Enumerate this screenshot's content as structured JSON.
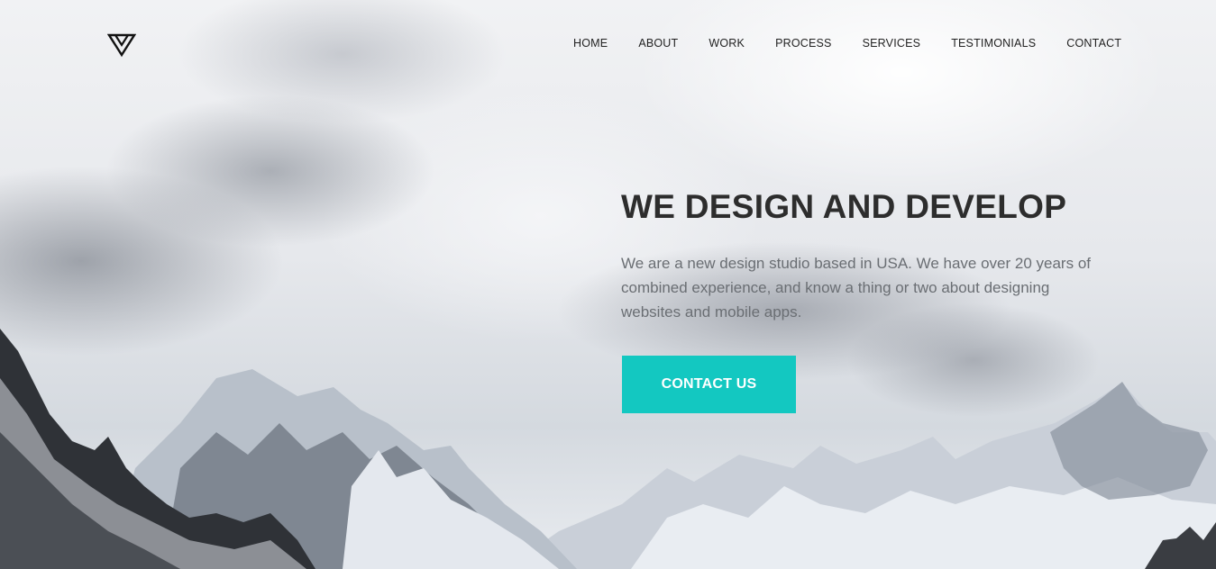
{
  "brand": {
    "logo_icon": "triangle-logo-icon"
  },
  "nav": {
    "items": [
      {
        "label": "HOME"
      },
      {
        "label": "ABOUT"
      },
      {
        "label": "WORK"
      },
      {
        "label": "PROCESS"
      },
      {
        "label": "SERVICES"
      },
      {
        "label": "TESTIMONIALS"
      },
      {
        "label": "CONTACT"
      }
    ]
  },
  "hero": {
    "headline": "WE DESIGN AND DEVELOP",
    "description": "We are a new design studio based in USA. We have over 20 years of combined experience, and know a thing or two about designing websites and mobile apps.",
    "cta_label": "CONTACT US"
  },
  "colors": {
    "accent": "#13c8c1",
    "headline": "#2d2d2d",
    "body_text": "#6a6e73",
    "nav_text": "#222222"
  }
}
